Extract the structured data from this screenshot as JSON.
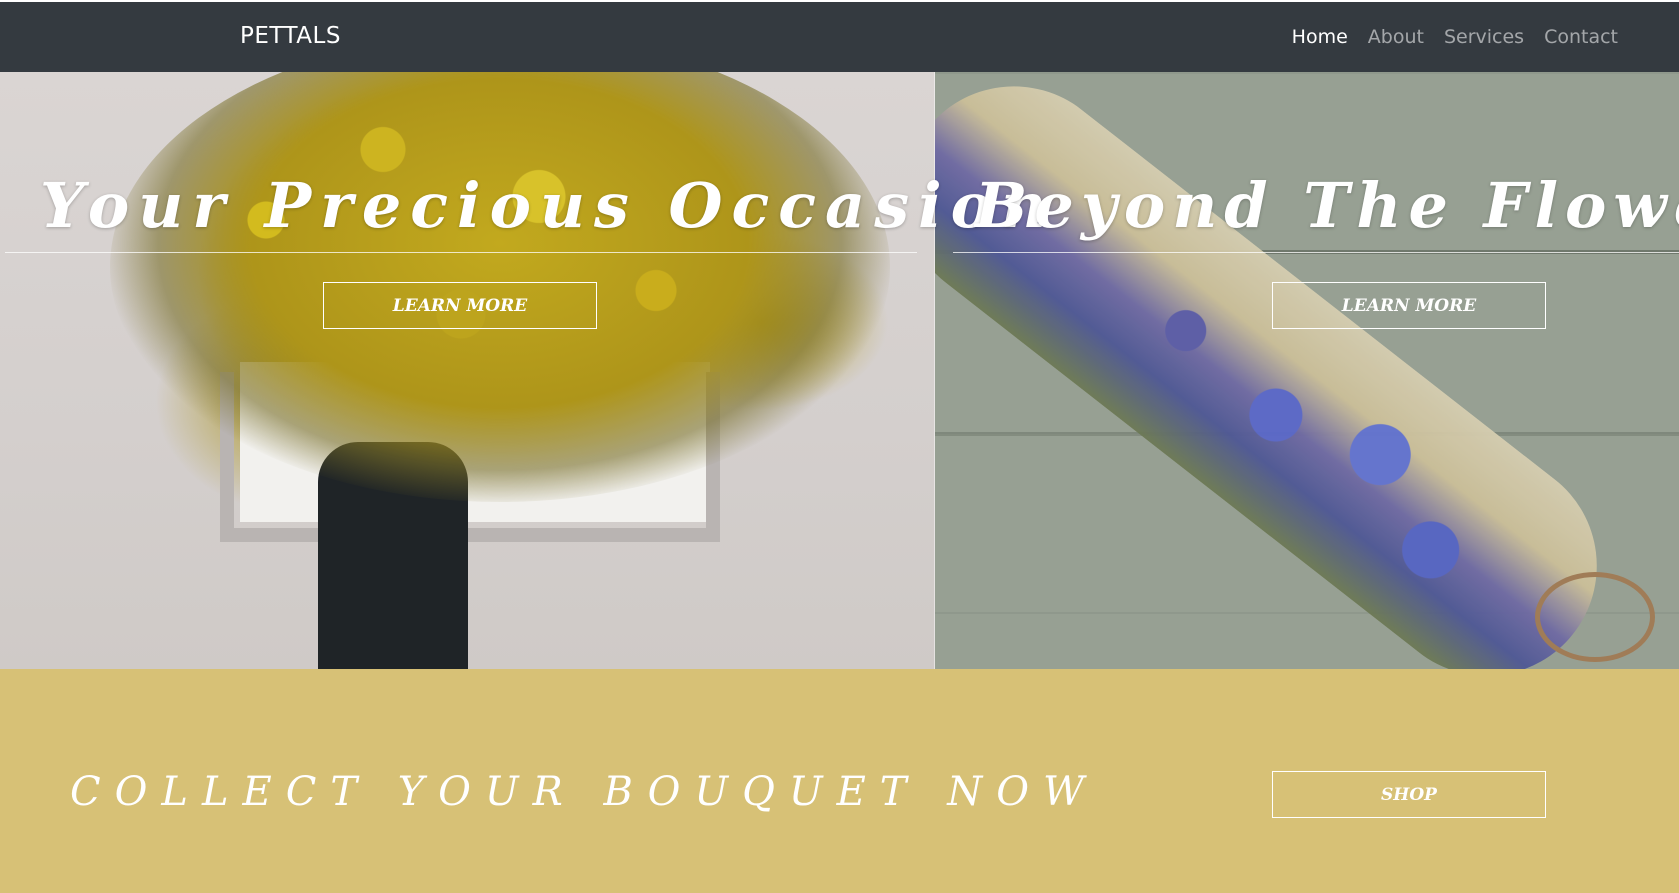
{
  "navbar": {
    "brand": "PETTALS",
    "links": [
      {
        "label": "Home",
        "active": true
      },
      {
        "label": "About",
        "active": false
      },
      {
        "label": "Services",
        "active": false
      },
      {
        "label": "Contact",
        "active": false
      }
    ]
  },
  "hero": {
    "panels": [
      {
        "title": "Your Precious Occasion",
        "button_label": "LEARN MORE",
        "image": "yellow-flower-bouquet-photo"
      },
      {
        "title": "Beyond The Flowery",
        "button_label": "LEARN MORE",
        "image": "lavender-wheat-bouquet-photo"
      }
    ]
  },
  "banner": {
    "text": "COLLECT YOUR BOUQUET NOW",
    "button_label": "SHOP"
  },
  "colors": {
    "navbar_bg": "#343a40",
    "banner_bg": "#d7c176",
    "text": "#ffffff"
  }
}
